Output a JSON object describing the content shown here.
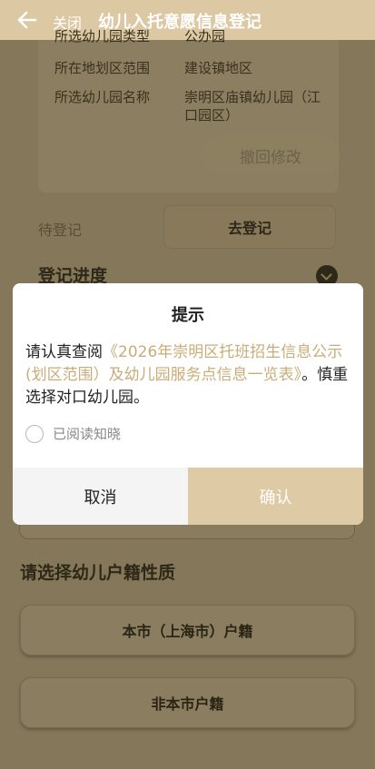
{
  "header": {
    "close_label": "关闭",
    "title": "幼儿入托意愿信息登记"
  },
  "info": {
    "rows": [
      {
        "label": "所选幼儿园类型",
        "value": "公办园"
      },
      {
        "label": "所在地划区范围",
        "value": "建设镇地区"
      },
      {
        "label": "所选幼儿园名称",
        "value": "崇明区庙镇幼儿园（江口园区）"
      }
    ],
    "retract_label": "撤回修改"
  },
  "registration": {
    "status": "待登记",
    "goto_label": "去登记",
    "progress_title": "登记进度"
  },
  "household": {
    "section_title": "请选择幼儿户籍性质",
    "options": [
      "本市（上海市）户籍",
      "非本市户籍"
    ]
  },
  "modal": {
    "title": "提示",
    "prefix": "请认真查阅",
    "link": "《2026年崇明区托班招生信息公示(划区范围）及幼儿园服务点信息一览表》",
    "suffix": "。慎重选择对口幼儿园。",
    "ack_label": "已阅读知晓",
    "cancel_label": "取消",
    "confirm_label": "确认"
  },
  "colors": {
    "accent": "#dcc9a3",
    "link": "#c9ad78",
    "confirm_bg": "#decaa5"
  }
}
